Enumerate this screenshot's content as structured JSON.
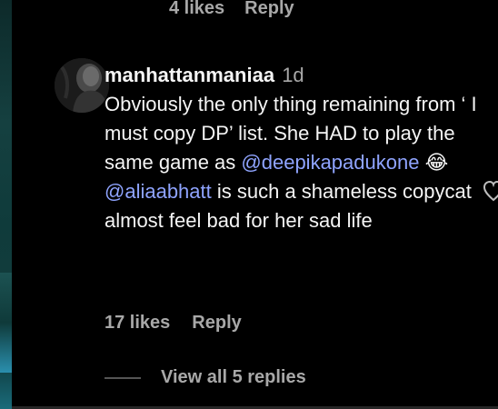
{
  "previous_comment": {
    "likes_label": "4 likes",
    "reply_label": "Reply"
  },
  "comment": {
    "username": "manhattanmaniaa",
    "time": "1d",
    "text_part1": "Obviously the only thing remaining from ‘ I must copy DP’ list. She HAD to play the same game as ",
    "mention1": "@deepikapadukone",
    "emoji": " 😂",
    "mention2": "@aliaabhatt",
    "text_part2": " is such a shameless copycat almost feel bad for her sad life",
    "likes_label": "17 likes",
    "reply_label": "Reply",
    "view_replies_label": "View all 5 replies"
  },
  "icons": {
    "like": "heart-icon",
    "avatar": "avatar"
  }
}
